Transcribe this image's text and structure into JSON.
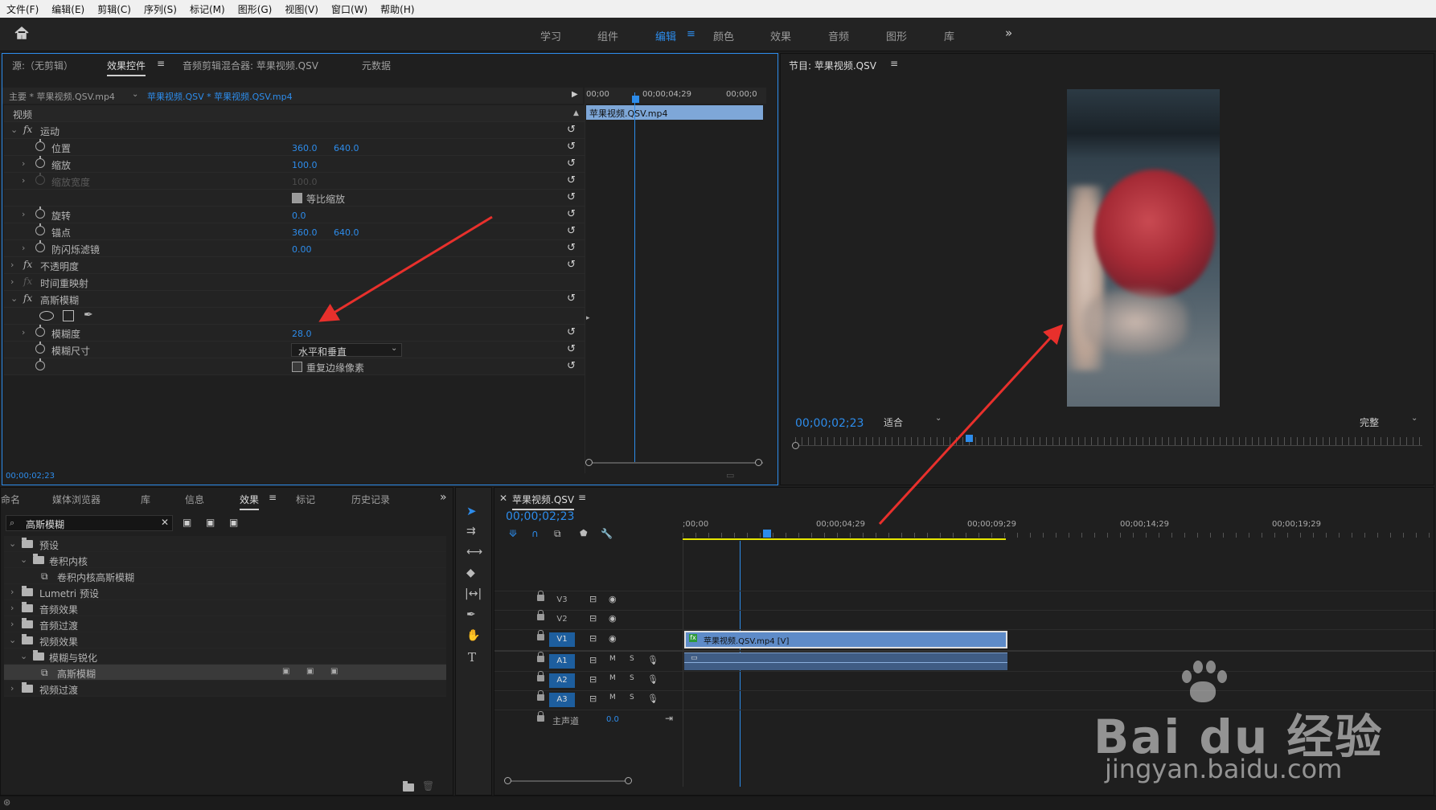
{
  "menu": [
    "文件(F)",
    "编辑(E)",
    "剪辑(C)",
    "序列(S)",
    "标记(M)",
    "图形(G)",
    "视图(V)",
    "窗口(W)",
    "帮助(H)"
  ],
  "workspaces": [
    "学习",
    "组件",
    "编辑",
    "颜色",
    "效果",
    "音频",
    "图形",
    "库"
  ],
  "workspace_menu_icon": "≡",
  "more_icon": "»",
  "source_panel": {
    "tabs": [
      "源:（无剪辑）",
      "效果控件",
      "音频剪辑混合器: 苹果视频.QSV",
      "元数据"
    ],
    "master_clip": "主要 * 苹果视频.QSV.mp4",
    "sequence_clip": "苹果视频.QSV * 苹果视频.QSV.mp4",
    "timecodes": [
      "00;00",
      "00;00;04;29",
      "00;00;0"
    ],
    "mini_clip": "苹果视频.QSV.mp4",
    "section": "视频",
    "props": [
      {
        "name": "运动",
        "fx": true
      },
      {
        "name": "位置",
        "v1": "360.0",
        "v2": "640.0"
      },
      {
        "name": "缩放",
        "v1": "100.0"
      },
      {
        "name": "缩放宽度",
        "v1": "100.0",
        "dim": true
      },
      {
        "name": "等比缩放",
        "checkbox": true
      },
      {
        "name": "旋转",
        "v1": "0.0"
      },
      {
        "name": "锚点",
        "v1": "360.0",
        "v2": "640.0"
      },
      {
        "name": "防闪烁滤镜",
        "v1": "0.00"
      },
      {
        "name": "不透明度",
        "fx": true
      },
      {
        "name": "时间重映射",
        "fx": true
      },
      {
        "name": "高斯模糊",
        "fx": true
      },
      {
        "name": "模糊度",
        "v1": "28.0"
      },
      {
        "name": "模糊尺寸",
        "dropdown": "水平和垂直"
      },
      {
        "name": "",
        "checkbox_label": "重复边缘像素"
      }
    ],
    "current_time": "00;00;02;23"
  },
  "program_panel": {
    "title": "节目: 苹果视频.QSV",
    "timecode": "00;00;02;23",
    "fit": "适合",
    "quality": "完整"
  },
  "effects_panel": {
    "tabs": [
      "命名",
      "媒体浏览器",
      "库",
      "信息",
      "效果",
      "标记",
      "历史记录"
    ],
    "search_value": "高斯模糊",
    "tree": [
      {
        "label": "预设",
        "level": 0,
        "open": true
      },
      {
        "label": "卷积内核",
        "level": 1,
        "open": true
      },
      {
        "label": "卷积内核高斯模糊",
        "level": 2,
        "preset": true
      },
      {
        "label": "Lumetri 预设",
        "level": 0
      },
      {
        "label": "音频效果",
        "level": 0
      },
      {
        "label": "音频过渡",
        "level": 0
      },
      {
        "label": "视频效果",
        "level": 0,
        "open": true
      },
      {
        "label": "模糊与锐化",
        "level": 1,
        "open": true
      },
      {
        "label": "高斯模糊",
        "level": 2,
        "selected": true
      },
      {
        "label": "视频过渡",
        "level": 0
      }
    ]
  },
  "timeline": {
    "title": "苹果视频.QSV",
    "timecode": "00;00;02;23",
    "ruler": [
      ";00;00",
      "00;00;04;29",
      "00;00;09;29",
      "00;00;14;29",
      "00;00;19;29"
    ],
    "video_tracks": [
      "V3",
      "V2",
      "V1"
    ],
    "audio_tracks": [
      "A1",
      "A2",
      "A3"
    ],
    "master_label": "主声道",
    "master_value": "0.0",
    "clip_label": "苹果视频.QSV.mp4 [V]",
    "m_label": "M",
    "s_label": "S"
  },
  "watermark": {
    "brand": "Bai du 经验",
    "url": "jingyan.baidu.com"
  },
  "colors": {
    "accent": "#2d8ceb",
    "clip": "#5e8bc8",
    "annotation": "#e8302c",
    "work_area": "#e6e600"
  }
}
